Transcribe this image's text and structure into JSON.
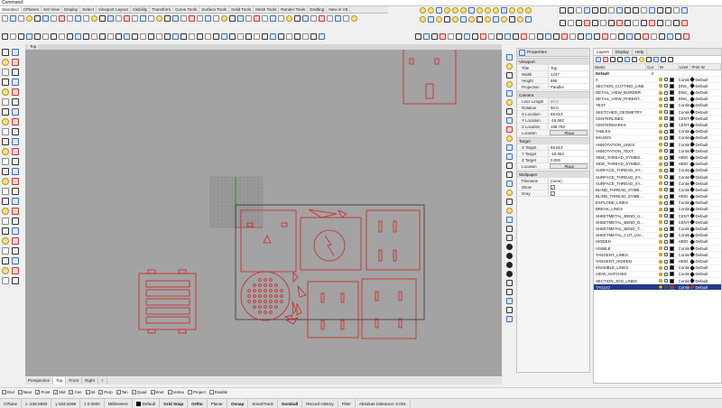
{
  "command_line": "Command:",
  "tabs": [
    "Standard",
    "CPlanes",
    "Set View",
    "Display",
    "Select",
    "Viewport Layout",
    "Visibility",
    "Transform",
    "Curve Tools",
    "Surface Tools",
    "Solid Tools",
    "Mesh Tools",
    "Render Tools",
    "Drafting",
    "New in V5"
  ],
  "active_tab": "Standard",
  "viewport": {
    "title": "Top",
    "tabs": [
      "Perspective",
      "Top",
      "Front",
      "Right"
    ],
    "active_tab": "Top",
    "add_tab_icon": "+"
  },
  "properties": {
    "header_title": "Properties",
    "sections": {
      "viewport": "Viewport",
      "camera": "Camera",
      "target": "Target",
      "wallpaper": "Wallpaper"
    },
    "viewport_rows": [
      {
        "k": "Title",
        "v": "Top"
      },
      {
        "k": "Width",
        "v": "1247"
      },
      {
        "k": "Height",
        "v": "866"
      },
      {
        "k": "Projection",
        "v": "Parallel"
      }
    ],
    "camera_rows": [
      {
        "k": "Lens Length",
        "v": "50.0"
      },
      {
        "k": "Rotation",
        "v": "90.0"
      },
      {
        "k": "X Location",
        "v": "69.613"
      },
      {
        "k": "Y Location",
        "v": "-18.062"
      },
      {
        "k": "Z Location",
        "v": "188.783"
      }
    ],
    "camera_location_label": "Location",
    "camera_location_btn": "Place",
    "target_rows": [
      {
        "k": "X Target",
        "v": "69.613"
      },
      {
        "k": "Y Target",
        "v": "-18.062"
      },
      {
        "k": "Z Target",
        "v": "0.000"
      }
    ],
    "target_location_label": "Location",
    "target_location_btn": "Place",
    "wallpaper_rows": [
      {
        "k": "Filename",
        "v": "(none)"
      }
    ],
    "wallpaper_show": "Show",
    "wallpaper_gray": "Gray"
  },
  "layers": {
    "tabs": [
      "Layers",
      "Display",
      "Help"
    ],
    "active_tab": "Layers",
    "columns": [
      "Name",
      "Cur",
      "M",
      "Linet",
      "Print W"
    ],
    "rows": [
      {
        "name": "Default",
        "current": "✓",
        "lt": "",
        "pc": "",
        "bold": true
      },
      {
        "name": "0",
        "lt": "Contin",
        "pc": "Default"
      },
      {
        "name": "SECTION_CUTTING_LINE",
        "lt": "DNS_",
        "pc": "Default"
      },
      {
        "name": "DETAIL_VIEW_BORDER",
        "lt": "DNS_",
        "pc": "Default"
      },
      {
        "name": "DETAIL_VIEW_PARENT...",
        "lt": "DNS_",
        "pc": "Default"
      },
      {
        "name": "TEXT",
        "lt": "Contin",
        "pc": "Default"
      },
      {
        "name": "SKETCHED_GEOMETRY",
        "lt": "Contin",
        "pc": "Default"
      },
      {
        "name": "CENTERLINES",
        "lt": "CENT",
        "pc": "Default"
      },
      {
        "name": "CENTERMARKS",
        "lt": "CENT",
        "pc": "Default"
      },
      {
        "name": "TABLES",
        "lt": "Contin",
        "pc": "Default"
      },
      {
        "name": "IMAGES",
        "lt": "Contin",
        "pc": "Default"
      },
      {
        "name": "ANNOTATION_LINES",
        "lt": "Contin",
        "pc": "Default"
      },
      {
        "name": "ANNOTATION_TEXT",
        "lt": "Contin",
        "pc": "Default"
      },
      {
        "name": "SIDE_THREAD_SYMBO...",
        "lt": "HIDD",
        "pc": "Default"
      },
      {
        "name": "SIDE_THREAD_SYMBO...",
        "lt": "HIDD",
        "pc": "Default"
      },
      {
        "name": "SURFACE_THREAD_SY...",
        "lt": "Contin",
        "pc": "Default"
      },
      {
        "name": "SURFACE_THREAD_SY...",
        "lt": "Contin",
        "pc": "Default"
      },
      {
        "name": "SURFACE_THREAD_SY...",
        "lt": "Contin",
        "pc": "Default"
      },
      {
        "name": "BLIND_THREAD_SYMB...",
        "lt": "Contin",
        "pc": "Default"
      },
      {
        "name": "BLIND_THREAD_SYMB...",
        "lt": "HIDD",
        "pc": "Default"
      },
      {
        "name": "EXPLODE_LINES",
        "lt": "Contin",
        "pc": "Default"
      },
      {
        "name": "BREAK_LINES",
        "lt": "Contin",
        "pc": "Default"
      },
      {
        "name": "SHEETMETAL_BEND_U...",
        "lt": "CENT",
        "pc": "Default"
      },
      {
        "name": "SHEETMETAL_BEND_D...",
        "lt": "CENT",
        "pc": "Default"
      },
      {
        "name": "SHEETMETAL_BEND_T...",
        "lt": "Contin",
        "pc": "Default"
      },
      {
        "name": "SHEETMETAL_CUT_LIN...",
        "lt": "Contin",
        "pc": "Default"
      },
      {
        "name": "HIDDEN",
        "lt": "HIDD",
        "pc": "Default"
      },
      {
        "name": "VISIBLE",
        "lt": "Contin",
        "pc": "Default"
      },
      {
        "name": "TANGENT_LINES",
        "lt": "Contin",
        "pc": "Default"
      },
      {
        "name": "TANGENT_HIDDEN",
        "lt": "HIDD",
        "pc": "Default"
      },
      {
        "name": "INVISIBLE_LINES",
        "lt": "Contin",
        "pc": "Default"
      },
      {
        "name": "VIEW_HATCHES",
        "lt": "Contin",
        "pc": "Default"
      },
      {
        "name": "SECTION_JOG_LINES",
        "lt": "Contin",
        "pc": "Default"
      },
      {
        "name": "TAGLIO",
        "lt": "Contin",
        "pc": "Default",
        "selected": true
      }
    ]
  },
  "osnaps": [
    {
      "label": "End",
      "checked": true
    },
    {
      "label": "Near",
      "checked": true
    },
    {
      "label": "Point",
      "checked": true
    },
    {
      "label": "Mid",
      "checked": true
    },
    {
      "label": "Cen",
      "checked": true
    },
    {
      "label": "Int",
      "checked": true
    },
    {
      "label": "Perp",
      "checked": true
    },
    {
      "label": "Tan",
      "checked": true
    },
    {
      "label": "Quad",
      "checked": true
    },
    {
      "label": "Knot",
      "checked": true
    },
    {
      "label": "Vertex",
      "checked": true
    },
    {
      "label": "Project",
      "checked": false
    },
    {
      "label": "Disable",
      "checked": false
    }
  ],
  "status": {
    "cplane": "CPlane",
    "x": "x -238.5993",
    "y": "y 263.3298",
    "z": "z 0.0000",
    "units": "Millimeters",
    "layer": "Default",
    "toggles": [
      "Grid Snap",
      "Ortho",
      "Planar",
      "Osnap",
      "SmartTrack",
      "Gumball",
      "Record History",
      "Filter"
    ],
    "tolerance": "Absolute tolerance: 0.001"
  },
  "colors": {
    "geometry": "#d42020",
    "viewport_bg": "#a3a3a3",
    "selected_layer": "#1e3a8a",
    "axis_green": "#1fa21f"
  }
}
